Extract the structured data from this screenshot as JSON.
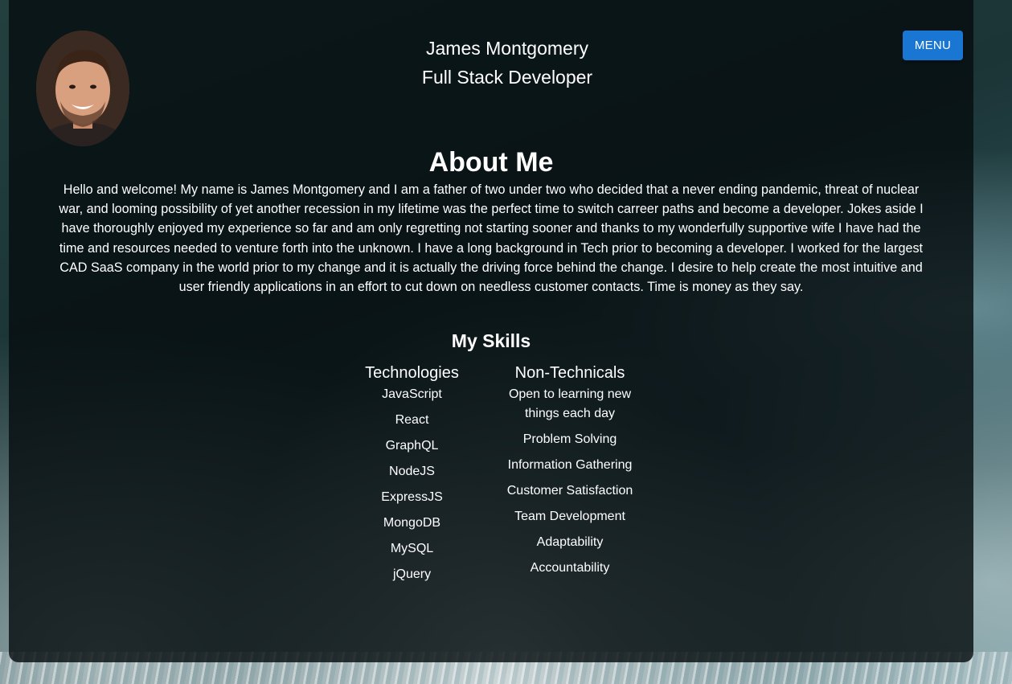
{
  "header": {
    "name": "James Montgomery",
    "role": "Full Stack Developer",
    "menu_label": "MENU"
  },
  "avatar": {
    "icon": "profile-photo"
  },
  "about": {
    "title": "About Me",
    "text": "Hello and welcome! My name is James Montgomery and I am a father of two under two who decided that a never ending pandemic, threat of nuclear war, and looming possibility of yet another recession in my lifetime was the perfect time to switch carreer paths and become a developer. Jokes aside I have thoroughly enjoyed my experience so far and am only regretting not starting sooner and thanks to my wonderfully supportive wife I have had the time and resources needed to venture forth into the unknown. I have a long background in Tech prior to becoming a developer. I worked for the largest CAD SaaS company in the world prior to my change and it is actually the driving force behind the change. I desire to help create the most intuitive and user friendly applications in an effort to cut down on needless customer contacts. Time is money as they say."
  },
  "skills": {
    "title": "My Skills",
    "technologies": {
      "heading": "Technologies",
      "items": [
        "JavaScript",
        "React",
        "GraphQL",
        "NodeJS",
        "ExpressJS",
        "MongoDB",
        "MySQL",
        "jQuery"
      ]
    },
    "non_technicals": {
      "heading": "Non-Technicals",
      "items": [
        "Open to learning new things each day",
        "Problem Solving",
        "Information Gathering",
        "Customer Satisfaction",
        "Team Development",
        "Adaptability",
        "Accountability"
      ]
    }
  },
  "colors": {
    "button": "#1976d2",
    "panel": "rgba(6,14,16,0.82)"
  }
}
